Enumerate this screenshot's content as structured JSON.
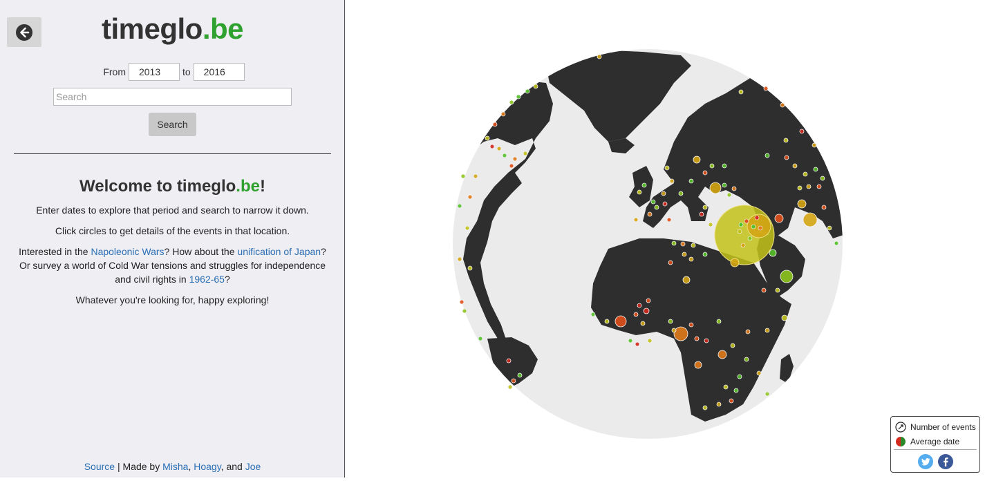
{
  "logo": {
    "main": "timeglo",
    "accent": ".be"
  },
  "dates": {
    "from_label": "From",
    "from_value": "2013",
    "to_label": "to",
    "to_value": "2016"
  },
  "search": {
    "placeholder": "Search",
    "button_label": "Search"
  },
  "welcome": {
    "prefix": "Welcome to ",
    "brand": "timeglo",
    "accent": ".be",
    "suffix": "!"
  },
  "intro": {
    "line1": "Enter dates to explore that period and search to narrow it down.",
    "line2": "Click circles to get details of the events in that location.",
    "para3_a": "Interested in the ",
    "link_napoleonic": "Napoleonic Wars",
    "para3_b": "? How about the ",
    "link_japan": "unification of Japan",
    "para3_c": "? Or survey a world of Cold War tensions and struggles for independence and civil rights in ",
    "link_1962": "1962-65",
    "para3_d": "?",
    "line4": "Whatever you're looking for, happy exploring!"
  },
  "footer": {
    "source": "Source",
    "sep": " | Made by ",
    "author1": "Misha",
    "comma": ", ",
    "author2": "Hoagy",
    "and": ", and ",
    "author3": "Joe"
  },
  "legend": {
    "size_label": "Number of events",
    "color_label": "Average date",
    "twitter_icon": "twitter-icon",
    "facebook_icon": "facebook-icon"
  },
  "colors": {
    "accent_green": "#2fa12f",
    "land": "#2e2e2e",
    "ocean": "#ebebeb",
    "link": "#2a6fb5",
    "event_old": "#d42a1e",
    "event_new": "#56c22a"
  }
}
